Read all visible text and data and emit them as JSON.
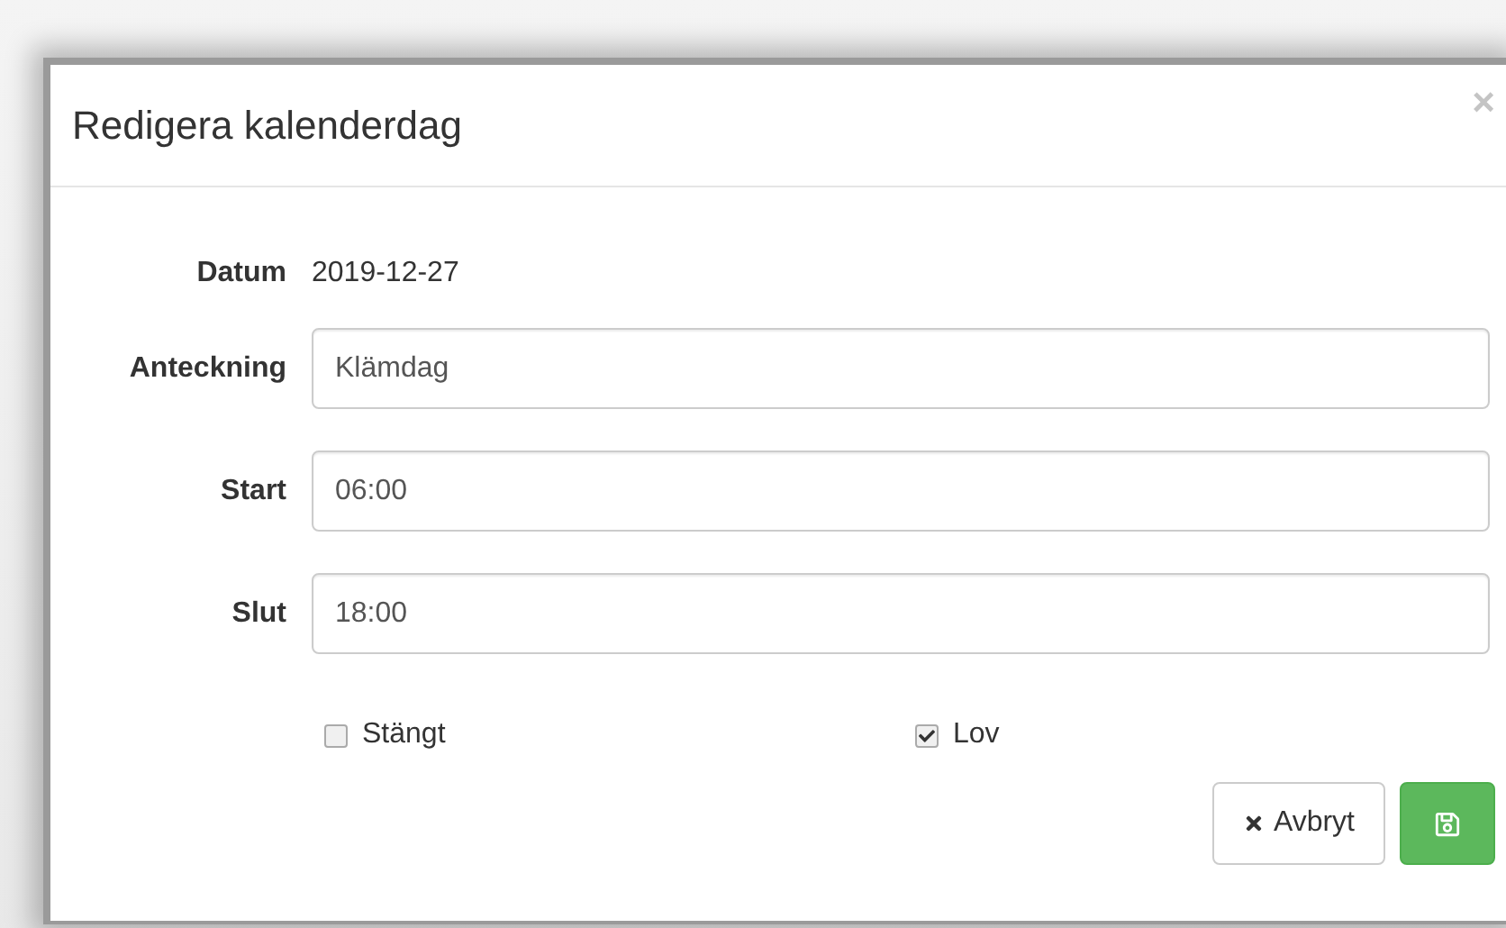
{
  "dialog": {
    "title": "Redigera kalenderdag",
    "close": "×"
  },
  "date": {
    "label": "Datum",
    "value": "2019-12-27"
  },
  "fields": [
    {
      "label": "Anteckning",
      "value": "Klämdag"
    },
    {
      "label": "Start",
      "value": "06:00"
    },
    {
      "label": "Slut",
      "value": "18:00"
    }
  ],
  "checkboxes": [
    {
      "label": "Stängt",
      "checked": false
    },
    {
      "label": "Lov",
      "checked": true
    }
  ],
  "buttons": {
    "cancel": "Avbryt"
  }
}
